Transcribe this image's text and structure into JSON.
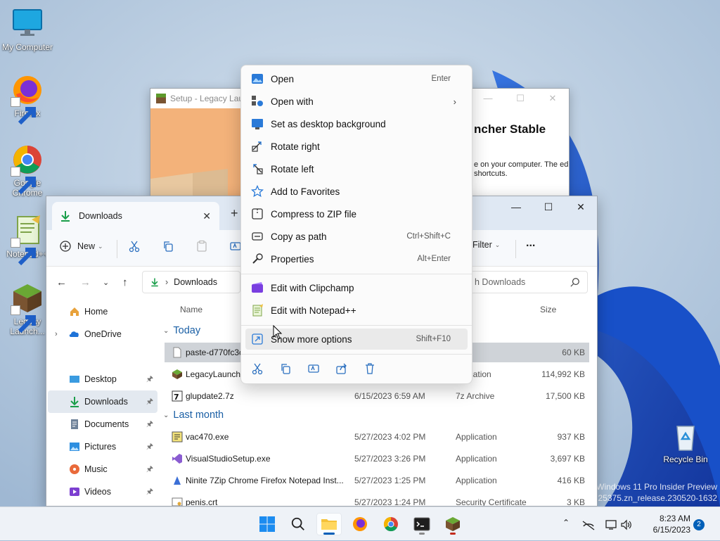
{
  "desktop": {
    "icons": [
      {
        "label": "My Computer",
        "icon": "monitor-icon"
      },
      {
        "label": "Firefox",
        "icon": "firefox-icon"
      },
      {
        "label": "Google Chrome",
        "icon": "chrome-icon"
      },
      {
        "label": "Notepad++",
        "icon": "notepadpp-icon"
      },
      {
        "label": "Legacy Launch...",
        "icon": "minecraft-icon"
      },
      {
        "label": "Recycle Bin",
        "icon": "recycle-bin-icon"
      }
    ],
    "watermark_line1": "Windows 11 Pro Insider Preview",
    "watermark_line2": "ild 25375.zn_release.230520-1632"
  },
  "setup_window": {
    "title": "Setup - Legacy Laun",
    "heading": "ncher Stable",
    "body": "e on your computer. The ed shortcuts."
  },
  "explorer": {
    "tab_title": "Downloads",
    "toolbar": {
      "new_label": "New",
      "filter_label": "Filter",
      "more_label": "..."
    },
    "address": "Downloads",
    "search_placeholder": "h Downloads",
    "nav": {
      "home": "Home",
      "onedrive": "OneDrive",
      "desktop": "Desktop",
      "downloads": "Downloads",
      "documents": "Documents",
      "pictures": "Pictures",
      "music": "Music",
      "videos": "Videos"
    },
    "columns": {
      "name": "Name",
      "size": "Size"
    },
    "groups": {
      "today": "Today",
      "last_month": "Last month"
    },
    "files": [
      {
        "name": "paste-d770fc3c",
        "date": "",
        "type": "File",
        "size": "60 KB"
      },
      {
        "name": "LegacyLaunche",
        "date": "",
        "type": "pplication",
        "size": "114,992 KB"
      },
      {
        "name": "glupdate2.7z",
        "date": "6/15/2023 6:59 AM",
        "type": "7z Archive",
        "size": "17,500 KB"
      },
      {
        "name": "vac470.exe",
        "date": "5/27/2023 4:02 PM",
        "type": "Application",
        "size": "937 KB"
      },
      {
        "name": "VisualStudioSetup.exe",
        "date": "5/27/2023 3:26 PM",
        "type": "Application",
        "size": "3,697 KB"
      },
      {
        "name": "Ninite 7Zip Chrome Firefox Notepad Inst...",
        "date": "5/27/2023 1:25 PM",
        "type": "Application",
        "size": "416 KB"
      },
      {
        "name": "penis.crt",
        "date": "5/27/2023 1:24 PM",
        "type": "Security Certificate",
        "size": "3 KB"
      }
    ]
  },
  "context_menu": {
    "items": [
      {
        "label": "Open",
        "shortcut": "Enter"
      },
      {
        "label": "Open with",
        "shortcut": ""
      },
      {
        "label": "Set as desktop background",
        "shortcut": ""
      },
      {
        "label": "Rotate right",
        "shortcut": ""
      },
      {
        "label": "Rotate left",
        "shortcut": ""
      },
      {
        "label": "Add to Favorites",
        "shortcut": ""
      },
      {
        "label": "Compress to ZIP file",
        "shortcut": ""
      },
      {
        "label": "Copy as path",
        "shortcut": "Ctrl+Shift+C"
      },
      {
        "label": "Properties",
        "shortcut": "Alt+Enter"
      },
      {
        "label": "Edit with Clipchamp",
        "shortcut": ""
      },
      {
        "label": "Edit with Notepad++",
        "shortcut": ""
      },
      {
        "label": "Show more options",
        "shortcut": "Shift+F10"
      }
    ]
  },
  "taskbar": {
    "time": "8:23 AM",
    "date": "6/15/2023",
    "notification_count": "2"
  },
  "colors": {
    "accent": "#005fb8",
    "selection": "#cfd3d8"
  }
}
